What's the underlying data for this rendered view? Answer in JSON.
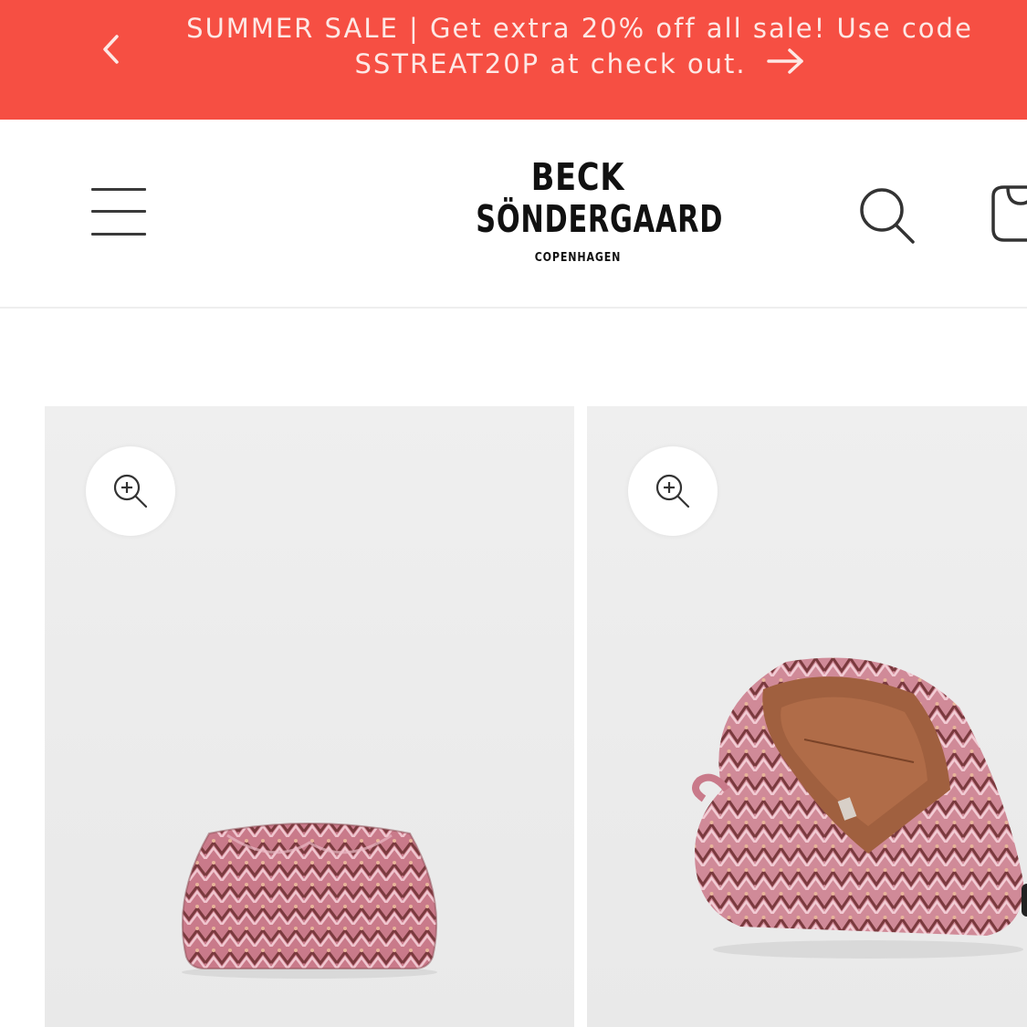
{
  "announcement": {
    "line1": "SUMMER SALE | Get extra 20% off all sale! Use code",
    "line2": "SSTREAT20P at check out.",
    "background": "#f64f43",
    "prev_icon": "chevron-left-icon",
    "next_icon": "arrow-right-icon"
  },
  "header": {
    "menu_icon": "hamburger-menu-icon",
    "logo": {
      "line1": "BECK",
      "line2": "SÖNDERGAARD",
      "line3": "COPENHAGEN"
    },
    "search_icon": "search-icon",
    "cart_icon": "cart-icon"
  },
  "gallery": {
    "zoom_icon": "zoom-in-icon",
    "images": [
      {
        "alt": "Patterned clutch bag front view"
      },
      {
        "alt": "Patterned clutch bag open interior view"
      }
    ]
  }
}
